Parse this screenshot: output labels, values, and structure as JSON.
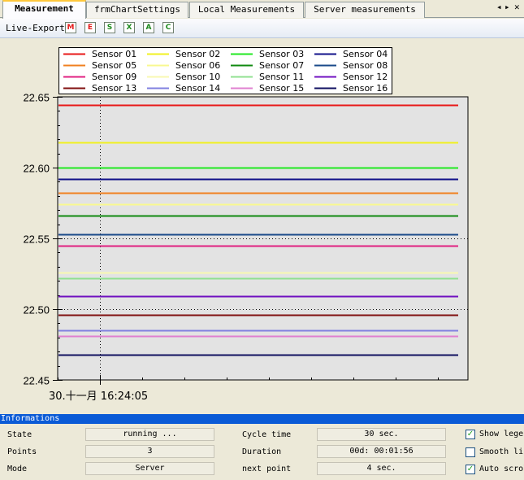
{
  "tabs": [
    {
      "label": "Measurement",
      "active": true
    },
    {
      "label": "frmChartSettings",
      "active": false
    },
    {
      "label": "Local Measurements",
      "active": false
    },
    {
      "label": "Server measurements",
      "active": false
    }
  ],
  "tab_nav": {
    "left": "◂",
    "right": "▸",
    "close": "✕"
  },
  "toolbar": {
    "label": "Live-Export",
    "buttons": [
      {
        "name": "export-m-button",
        "glyph": "M",
        "color": "#e41b1b"
      },
      {
        "name": "export-e-button",
        "glyph": "E",
        "color": "#e41b1b"
      },
      {
        "name": "export-s-button",
        "glyph": "S",
        "color": "#1f8a1f"
      },
      {
        "name": "export-x-button",
        "glyph": "X",
        "color": "#1f8a1f"
      },
      {
        "name": "export-a-button",
        "glyph": "A",
        "color": "#1f8a1f"
      },
      {
        "name": "export-c-button",
        "glyph": "C",
        "color": "#1f8a1f"
      }
    ]
  },
  "chart_data": {
    "type": "line",
    "x_tick_labels": [
      "30.十一月 16:24:05"
    ],
    "ylim": [
      22.45,
      22.65
    ],
    "y_ticks": [
      22.45,
      22.5,
      22.55,
      22.6,
      22.65
    ],
    "y_tick_labels": [
      "22.45",
      "22.50",
      "22.55",
      "22.60",
      "22.65"
    ],
    "legend_placement": "top",
    "grid": "dotted",
    "series": [
      {
        "name": "Sensor 01",
        "color": "#e81818",
        "value": 22.644
      },
      {
        "name": "Sensor 02",
        "color": "#f0f020",
        "value": 22.618
      },
      {
        "name": "Sensor 03",
        "color": "#20e820",
        "value": 22.6
      },
      {
        "name": "Sensor 04",
        "color": "#10108a",
        "value": 22.592
      },
      {
        "name": "Sensor 05",
        "color": "#f08020",
        "value": 22.582
      },
      {
        "name": "Sensor 06",
        "color": "#f8f890",
        "value": 22.574
      },
      {
        "name": "Sensor 07",
        "color": "#108a10",
        "value": 22.566
      },
      {
        "name": "Sensor 08",
        "color": "#1a4a8a",
        "value": 22.553
      },
      {
        "name": "Sensor 09",
        "color": "#e02080",
        "value": 22.545
      },
      {
        "name": "Sensor 10",
        "color": "#f8f8b0",
        "value": 22.526
      },
      {
        "name": "Sensor 11",
        "color": "#90e090",
        "value": 22.522
      },
      {
        "name": "Sensor 12",
        "color": "#7010c0",
        "value": 22.509
      },
      {
        "name": "Sensor 13",
        "color": "#801010",
        "value": 22.496
      },
      {
        "name": "Sensor 14",
        "color": "#8080e0",
        "value": 22.485
      },
      {
        "name": "Sensor 15",
        "color": "#e080d0",
        "value": 22.481
      },
      {
        "name": "Sensor 16",
        "color": "#101060",
        "value": 22.468
      }
    ]
  },
  "info": {
    "header": "Informations",
    "state_label": "State",
    "state_value": "running ...",
    "points_label": "Points",
    "points_value": "3",
    "mode_label": "Mode",
    "mode_value": "Server",
    "cycle_label": "Cycle time",
    "cycle_value": "30 sec.",
    "duration_label": "Duration",
    "duration_value": "00d: 00:01:56",
    "next_label": "next point",
    "next_value": "4 sec.",
    "checkboxes": [
      {
        "label": "Show legend",
        "checked": true
      },
      {
        "label": "Smooth lines",
        "checked": false
      },
      {
        "label": "Auto scroll",
        "checked": true
      }
    ]
  }
}
